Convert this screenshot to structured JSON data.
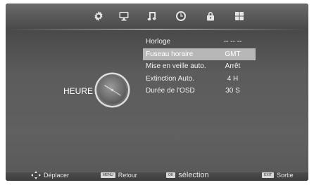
{
  "tabs": [
    {
      "id": "picture",
      "icon": "gear-icon"
    },
    {
      "id": "screen",
      "icon": "monitor-icon"
    },
    {
      "id": "sound",
      "icon": "music-note-icon"
    },
    {
      "id": "time",
      "icon": "clock-icon"
    },
    {
      "id": "lock",
      "icon": "lock-icon"
    },
    {
      "id": "options",
      "icon": "grid-icon"
    }
  ],
  "section": {
    "title": "HEURE",
    "icon": "clock-icon"
  },
  "menu": [
    {
      "label": "Horloge",
      "value": "-- -- --",
      "selected": false
    },
    {
      "label": "Fuseau horaire",
      "value": "GMT",
      "selected": true
    },
    {
      "label": "Mise en veille auto.",
      "value": "Arrêt",
      "selected": false
    },
    {
      "label": "Extinction Auto.",
      "value": "4 H",
      "selected": false
    },
    {
      "label": "Durée de l'OSD",
      "value": "30 S",
      "selected": false
    }
  ],
  "footer": {
    "move_label": "Déplacer",
    "menu_key": "MENU",
    "back_label": "Retour",
    "ok_key": "OK",
    "select_label": "sélection",
    "exit_key": "EXIT",
    "exit_label": "Sortie"
  },
  "colors": {
    "selected_row": "#b7b7b7",
    "background": "#5c5c5c"
  }
}
